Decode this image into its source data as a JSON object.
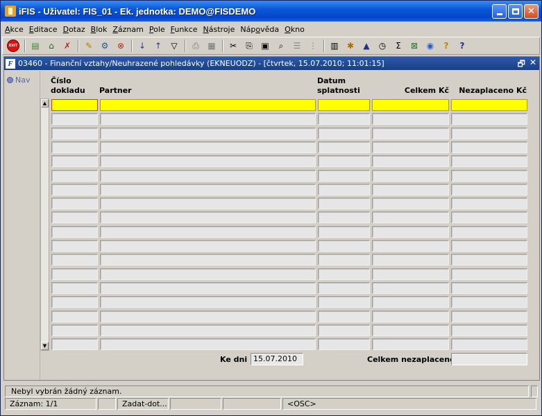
{
  "window": {
    "title": "iFIS - Uživatel: FIS_01 - Ek. jednotka: DEMO@FISDEMO"
  },
  "menu": [
    {
      "u": "A",
      "rest": "kce"
    },
    {
      "u": "E",
      "rest": "ditace"
    },
    {
      "u": "D",
      "rest": "otaz"
    },
    {
      "u": "B",
      "rest": "lok"
    },
    {
      "u": "Z",
      "rest": "áznam"
    },
    {
      "u": "P",
      "rest": "ole"
    },
    {
      "u": "F",
      "rest": "unkce"
    },
    {
      "u": "N",
      "rest": "ástroje"
    },
    {
      "pre": "Náp",
      "u": "o",
      "rest": "věda"
    },
    {
      "u": "O",
      "rest": "kno"
    }
  ],
  "toolbar": {
    "exit_label": "EXIT"
  },
  "child": {
    "title": "03460 - Finanční vztahy/Neuhrazené pohledávky (EKNEUODZ) - [čtvrtek, 15.07.2010; 11:01:15]",
    "icon_letter": "F"
  },
  "nav": {
    "label": "Nav"
  },
  "columns": {
    "doc_line1": "Číslo",
    "doc_line2": "dokladu",
    "partner": "Partner",
    "due_line1": "Datum",
    "due_line2": "splatnosti",
    "total": "Celkem Kč",
    "unpaid": "Nezaplaceno Kč"
  },
  "footer": {
    "as_of_label": "Ke dni",
    "as_of_value": "15.07.2010",
    "total_unpaid_label": "Celkem nezaplaceno",
    "total_unpaid_value": ""
  },
  "status": {
    "message": "Nebyl vybrán žádný záznam.",
    "record": "Záznam: 1/1",
    "seg2": "",
    "mode": "Zadat-dot...",
    "seg4": "",
    "seg5": "",
    "osc": "<OSC>"
  }
}
